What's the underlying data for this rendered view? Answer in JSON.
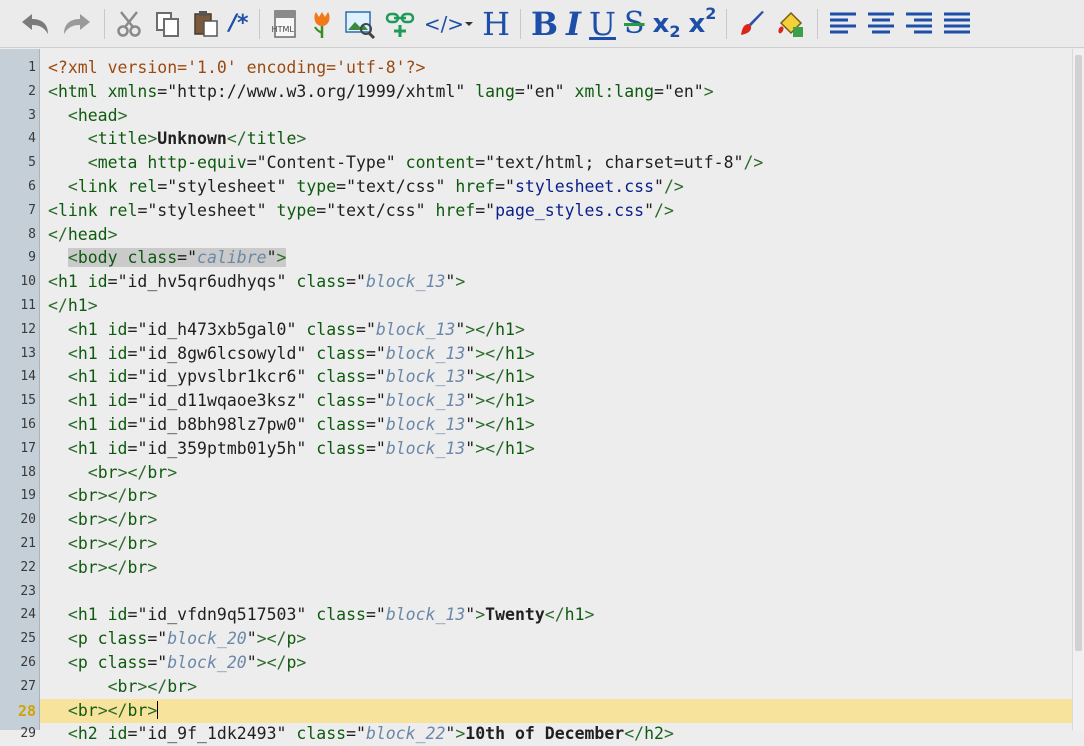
{
  "toolbar": {
    "html_badge": "HTML",
    "heading_label": "H",
    "bold_label": "B",
    "italic_label": "I",
    "underline_label": "U",
    "strike_label": "S",
    "subscript_base": "x",
    "subscript_index": "2",
    "superscript_base": "x",
    "superscript_index": "2",
    "comment_label": "/*",
    "code_label": "</>"
  },
  "editor": {
    "current_line": 28,
    "lines": [
      {
        "n": "1",
        "tokens": [
          [
            "pi",
            "<?xml version='1.0' encoding='utf-8'?>"
          ]
        ]
      },
      {
        "n": "2",
        "tokens": [
          [
            "br",
            "<"
          ],
          [
            "tag",
            "html"
          ],
          [
            "attr",
            " xmlns"
          ],
          [
            "eq",
            "="
          ],
          [
            "str",
            "\"http://www.w3.org/1999/xhtml\""
          ],
          [
            "attr",
            " lang"
          ],
          [
            "eq",
            "="
          ],
          [
            "str",
            "\"en\""
          ],
          [
            "attr",
            " xml:lang"
          ],
          [
            "eq",
            "="
          ],
          [
            "str",
            "\"en\""
          ],
          [
            "br",
            ">"
          ]
        ]
      },
      {
        "n": "3",
        "tokens": [
          [
            "ws",
            "  "
          ],
          [
            "br",
            "<"
          ],
          [
            "tag",
            "head"
          ],
          [
            "br",
            ">"
          ]
        ]
      },
      {
        "n": "4",
        "tokens": [
          [
            "ws",
            "    "
          ],
          [
            "br",
            "<"
          ],
          [
            "tag",
            "title"
          ],
          [
            "br",
            ">"
          ],
          [
            "txt",
            "Unknown"
          ],
          [
            "br",
            "</"
          ],
          [
            "tag",
            "title"
          ],
          [
            "br",
            ">"
          ]
        ]
      },
      {
        "n": "5",
        "tokens": [
          [
            "ws",
            "    "
          ],
          [
            "br",
            "<"
          ],
          [
            "tag",
            "meta"
          ],
          [
            "attr",
            " http-equiv"
          ],
          [
            "eq",
            "="
          ],
          [
            "str",
            "\"Content-Type\""
          ],
          [
            "attr",
            " content"
          ],
          [
            "eq",
            "="
          ],
          [
            "str",
            "\"text/html; charset=utf-8\""
          ],
          [
            "br",
            "/>"
          ]
        ]
      },
      {
        "n": "6",
        "tokens": [
          [
            "ws",
            "  "
          ],
          [
            "br",
            "<"
          ],
          [
            "tag",
            "link"
          ],
          [
            "attr",
            " rel"
          ],
          [
            "eq",
            "="
          ],
          [
            "str",
            "\"stylesheet\""
          ],
          [
            "attr",
            " type"
          ],
          [
            "eq",
            "="
          ],
          [
            "str",
            "\"text/css\""
          ],
          [
            "attr",
            " href"
          ],
          [
            "eq",
            "="
          ],
          [
            "str",
            "\""
          ],
          [
            "link",
            "stylesheet.css"
          ],
          [
            "str",
            "\""
          ],
          [
            "br",
            "/>"
          ]
        ]
      },
      {
        "n": "7",
        "tokens": [
          [
            "br",
            "<"
          ],
          [
            "tag",
            "link"
          ],
          [
            "attr",
            " rel"
          ],
          [
            "eq",
            "="
          ],
          [
            "str",
            "\"stylesheet\""
          ],
          [
            "attr",
            " type"
          ],
          [
            "eq",
            "="
          ],
          [
            "str",
            "\"text/css\""
          ],
          [
            "attr",
            " href"
          ],
          [
            "eq",
            "="
          ],
          [
            "str",
            "\""
          ],
          [
            "link",
            "page_styles.css"
          ],
          [
            "str",
            "\""
          ],
          [
            "br",
            "/>"
          ]
        ]
      },
      {
        "n": "8",
        "tokens": [
          [
            "br",
            "</"
          ],
          [
            "tag",
            "head"
          ],
          [
            "br",
            ">"
          ]
        ]
      },
      {
        "n": "9",
        "tokens": [
          [
            "ws",
            "  "
          ],
          [
            "hlstart",
            ""
          ],
          [
            "br",
            "<"
          ],
          [
            "tag",
            "body"
          ],
          [
            "attr",
            " class"
          ],
          [
            "eq",
            "="
          ],
          [
            "str",
            "\""
          ],
          [
            "cls",
            "calibre"
          ],
          [
            "str",
            "\""
          ],
          [
            "br",
            ">"
          ],
          [
            "hlend",
            ""
          ]
        ]
      },
      {
        "n": "10",
        "tokens": [
          [
            "br",
            "<"
          ],
          [
            "tag",
            "h1"
          ],
          [
            "attr",
            " id"
          ],
          [
            "eq",
            "="
          ],
          [
            "str",
            "\"id_hv5qr6udhyqs\""
          ],
          [
            "attr",
            " class"
          ],
          [
            "eq",
            "="
          ],
          [
            "str",
            "\""
          ],
          [
            "cls",
            "block_13"
          ],
          [
            "str",
            "\""
          ],
          [
            "br",
            ">"
          ]
        ]
      },
      {
        "n": "11",
        "tokens": [
          [
            "br",
            "</"
          ],
          [
            "tag",
            "h1"
          ],
          [
            "br",
            ">"
          ]
        ]
      },
      {
        "n": "12",
        "tokens": [
          [
            "ws",
            "  "
          ],
          [
            "br",
            "<"
          ],
          [
            "tag",
            "h1"
          ],
          [
            "attr",
            " id"
          ],
          [
            "eq",
            "="
          ],
          [
            "str",
            "\"id_h473xb5gal0\""
          ],
          [
            "attr",
            " class"
          ],
          [
            "eq",
            "="
          ],
          [
            "str",
            "\""
          ],
          [
            "cls",
            "block_13"
          ],
          [
            "str",
            "\""
          ],
          [
            "br",
            "></"
          ],
          [
            "tag",
            "h1"
          ],
          [
            "br",
            ">"
          ]
        ]
      },
      {
        "n": "13",
        "tokens": [
          [
            "ws",
            "  "
          ],
          [
            "br",
            "<"
          ],
          [
            "tag",
            "h1"
          ],
          [
            "attr",
            " id"
          ],
          [
            "eq",
            "="
          ],
          [
            "str",
            "\"id_8gw6lcsowyld\""
          ],
          [
            "attr",
            " class"
          ],
          [
            "eq",
            "="
          ],
          [
            "str",
            "\""
          ],
          [
            "cls",
            "block_13"
          ],
          [
            "str",
            "\""
          ],
          [
            "br",
            "></"
          ],
          [
            "tag",
            "h1"
          ],
          [
            "br",
            ">"
          ]
        ]
      },
      {
        "n": "14",
        "tokens": [
          [
            "ws",
            "  "
          ],
          [
            "br",
            "<"
          ],
          [
            "tag",
            "h1"
          ],
          [
            "attr",
            " id"
          ],
          [
            "eq",
            "="
          ],
          [
            "str",
            "\"id_ypvslbr1kcr6\""
          ],
          [
            "attr",
            " class"
          ],
          [
            "eq",
            "="
          ],
          [
            "str",
            "\""
          ],
          [
            "cls",
            "block_13"
          ],
          [
            "str",
            "\""
          ],
          [
            "br",
            "></"
          ],
          [
            "tag",
            "h1"
          ],
          [
            "br",
            ">"
          ]
        ]
      },
      {
        "n": "15",
        "tokens": [
          [
            "ws",
            "  "
          ],
          [
            "br",
            "<"
          ],
          [
            "tag",
            "h1"
          ],
          [
            "attr",
            " id"
          ],
          [
            "eq",
            "="
          ],
          [
            "str",
            "\"id_d11wqaoe3ksz\""
          ],
          [
            "attr",
            " class"
          ],
          [
            "eq",
            "="
          ],
          [
            "str",
            "\""
          ],
          [
            "cls",
            "block_13"
          ],
          [
            "str",
            "\""
          ],
          [
            "br",
            "></"
          ],
          [
            "tag",
            "h1"
          ],
          [
            "br",
            ">"
          ]
        ]
      },
      {
        "n": "16",
        "tokens": [
          [
            "ws",
            "  "
          ],
          [
            "br",
            "<"
          ],
          [
            "tag",
            "h1"
          ],
          [
            "attr",
            " id"
          ],
          [
            "eq",
            "="
          ],
          [
            "str",
            "\"id_b8bh98lz7pw0\""
          ],
          [
            "attr",
            " class"
          ],
          [
            "eq",
            "="
          ],
          [
            "str",
            "\""
          ],
          [
            "cls",
            "block_13"
          ],
          [
            "str",
            "\""
          ],
          [
            "br",
            "></"
          ],
          [
            "tag",
            "h1"
          ],
          [
            "br",
            ">"
          ]
        ]
      },
      {
        "n": "17",
        "tokens": [
          [
            "ws",
            "  "
          ],
          [
            "br",
            "<"
          ],
          [
            "tag",
            "h1"
          ],
          [
            "attr",
            " id"
          ],
          [
            "eq",
            "="
          ],
          [
            "str",
            "\"id_359ptmb01y5h\""
          ],
          [
            "attr",
            " class"
          ],
          [
            "eq",
            "="
          ],
          [
            "str",
            "\""
          ],
          [
            "cls",
            "block_13"
          ],
          [
            "str",
            "\""
          ],
          [
            "br",
            "></"
          ],
          [
            "tag",
            "h1"
          ],
          [
            "br",
            ">"
          ]
        ]
      },
      {
        "n": "18",
        "tokens": [
          [
            "ws",
            "    "
          ],
          [
            "br",
            "<"
          ],
          [
            "tag",
            "br"
          ],
          [
            "br",
            "></"
          ],
          [
            "tag",
            "br"
          ],
          [
            "br",
            ">"
          ]
        ]
      },
      {
        "n": "19",
        "tokens": [
          [
            "ws",
            "  "
          ],
          [
            "br",
            "<"
          ],
          [
            "tag",
            "br"
          ],
          [
            "br",
            "></"
          ],
          [
            "tag",
            "br"
          ],
          [
            "br",
            ">"
          ]
        ]
      },
      {
        "n": "20",
        "tokens": [
          [
            "ws",
            "  "
          ],
          [
            "br",
            "<"
          ],
          [
            "tag",
            "br"
          ],
          [
            "br",
            "></"
          ],
          [
            "tag",
            "br"
          ],
          [
            "br",
            ">"
          ]
        ]
      },
      {
        "n": "21",
        "tokens": [
          [
            "ws",
            "  "
          ],
          [
            "br",
            "<"
          ],
          [
            "tag",
            "br"
          ],
          [
            "br",
            "></"
          ],
          [
            "tag",
            "br"
          ],
          [
            "br",
            ">"
          ]
        ]
      },
      {
        "n": "22",
        "tokens": [
          [
            "ws",
            "  "
          ],
          [
            "br",
            "<"
          ],
          [
            "tag",
            "br"
          ],
          [
            "br",
            "></"
          ],
          [
            "tag",
            "br"
          ],
          [
            "br",
            ">"
          ]
        ]
      },
      {
        "n": "23",
        "tokens": []
      },
      {
        "n": "24",
        "tokens": [
          [
            "ws",
            "  "
          ],
          [
            "br",
            "<"
          ],
          [
            "tag",
            "h1"
          ],
          [
            "attr",
            " id"
          ],
          [
            "eq",
            "="
          ],
          [
            "str",
            "\"id_vfdn9q517503\""
          ],
          [
            "attr",
            " class"
          ],
          [
            "eq",
            "="
          ],
          [
            "str",
            "\""
          ],
          [
            "cls",
            "block_13"
          ],
          [
            "str",
            "\""
          ],
          [
            "br",
            ">"
          ],
          [
            "txt",
            "Twenty"
          ],
          [
            "br",
            "</"
          ],
          [
            "tag",
            "h1"
          ],
          [
            "br",
            ">"
          ]
        ]
      },
      {
        "n": "25",
        "tokens": [
          [
            "ws",
            "  "
          ],
          [
            "br",
            "<"
          ],
          [
            "tag",
            "p"
          ],
          [
            "attr",
            " class"
          ],
          [
            "eq",
            "="
          ],
          [
            "str",
            "\""
          ],
          [
            "cls",
            "block_20"
          ],
          [
            "str",
            "\""
          ],
          [
            "br",
            "></"
          ],
          [
            "tag",
            "p"
          ],
          [
            "br",
            ">"
          ]
        ]
      },
      {
        "n": "26",
        "tokens": [
          [
            "ws",
            "  "
          ],
          [
            "br",
            "<"
          ],
          [
            "tag",
            "p"
          ],
          [
            "attr",
            " class"
          ],
          [
            "eq",
            "="
          ],
          [
            "str",
            "\""
          ],
          [
            "cls",
            "block_20"
          ],
          [
            "str",
            "\""
          ],
          [
            "br",
            "></"
          ],
          [
            "tag",
            "p"
          ],
          [
            "br",
            ">"
          ]
        ]
      },
      {
        "n": "27",
        "tokens": [
          [
            "ws",
            "      "
          ],
          [
            "br",
            "<"
          ],
          [
            "tag",
            "br"
          ],
          [
            "br",
            "></"
          ],
          [
            "tag",
            "br"
          ],
          [
            "br",
            ">"
          ]
        ]
      },
      {
        "n": "28",
        "tokens": [
          [
            "ws",
            "  "
          ],
          [
            "br",
            "<"
          ],
          [
            "tag",
            "br"
          ],
          [
            "br",
            "></"
          ],
          [
            "tag",
            "br"
          ],
          [
            "br",
            ">"
          ],
          [
            "cursor",
            ""
          ]
        ]
      },
      {
        "n": "29",
        "tokens": [
          [
            "ws",
            "  "
          ],
          [
            "br",
            "<"
          ],
          [
            "tag",
            "h2"
          ],
          [
            "attr",
            " id"
          ],
          [
            "eq",
            "="
          ],
          [
            "str",
            "\"id_9f_1dk2493\""
          ],
          [
            "attr",
            " class"
          ],
          [
            "eq",
            "="
          ],
          [
            "str",
            "\""
          ],
          [
            "cls",
            "block_22"
          ],
          [
            "str",
            "\""
          ],
          [
            "br",
            ">"
          ],
          [
            "txt",
            "10th of December"
          ],
          [
            "br",
            "</"
          ],
          [
            "tag",
            "h2"
          ],
          [
            "br",
            ">"
          ]
        ]
      }
    ]
  }
}
